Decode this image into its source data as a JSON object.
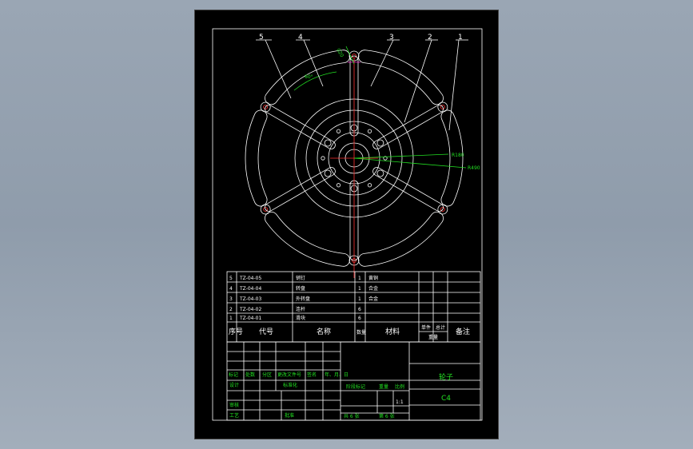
{
  "balloons": [
    "5",
    "4",
    "3",
    "2",
    "1"
  ],
  "dimensions": {
    "angle": "60°",
    "top": "020",
    "r1": "R180",
    "r2": "R490"
  },
  "parts_list": {
    "rows": [
      {
        "no": "5",
        "code": "TZ-04-05",
        "name": "销钉",
        "qty": "1",
        "material": "黄铜"
      },
      {
        "no": "4",
        "code": "TZ-04-04",
        "name": "转盘",
        "qty": "1",
        "material": "合金"
      },
      {
        "no": "3",
        "code": "TZ-04-03",
        "name": "外转盘",
        "qty": "1",
        "material": "合金"
      },
      {
        "no": "2",
        "code": "TZ-04-02",
        "name": "连杆",
        "qty": "6",
        "material": ""
      },
      {
        "no": "1",
        "code": "TZ-04-01",
        "name": "滑块",
        "qty": "6",
        "material": ""
      }
    ],
    "header": {
      "no": "序号",
      "code": "代号",
      "name": "名称",
      "qty": "数量",
      "material": "材料",
      "single": "单件",
      "total": "总计",
      "weight": "重量",
      "remark": "备注"
    }
  },
  "title_block": {
    "rev_row": [
      "标记",
      "处数",
      "分区",
      "更改文件号",
      "签名",
      "年、月、日"
    ],
    "design": "设计",
    "standard": "标准化",
    "review": "审核",
    "process": "工艺",
    "approve": "批准",
    "stage_mark": "阶段标记",
    "weight": "重量",
    "scale": "比例",
    "scale_value": "1:1",
    "sheet_total": "共 6 张",
    "sheet_no": "第 6 张",
    "part_name": "轮子",
    "part_code": "C4"
  }
}
